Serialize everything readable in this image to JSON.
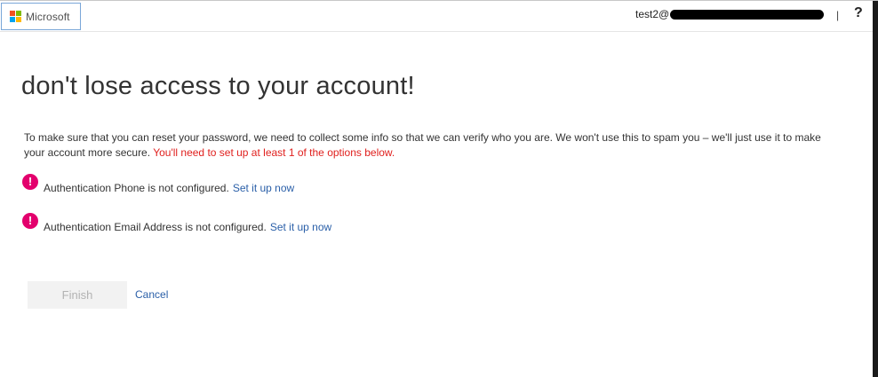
{
  "header": {
    "logo_text": "Microsoft",
    "user_prefix": "test2@",
    "separator": "|",
    "help": "?"
  },
  "logo_colors": [
    "#f25022",
    "#7fba00",
    "#00a4ef",
    "#ffb900"
  ],
  "main": {
    "title": "don't lose access to your account!",
    "intro_text": "To make sure that you can reset your password, we need to collect some info so that we can verify who you are. We won't use this to spam you – we'll just use it to make your account more secure.",
    "intro_warning": "You'll need to set up at least 1 of the options below.",
    "items": [
      {
        "icon": "!",
        "text": "Authentication Phone is not configured.",
        "link": "Set it up now"
      },
      {
        "icon": "!",
        "text": "Authentication Email Address is not configured.",
        "link": "Set it up now"
      }
    ],
    "finish_label": "Finish",
    "cancel_label": "Cancel"
  },
  "colors": {
    "alert": "#e3006d",
    "link": "#2a5fa8",
    "warning": "#e0201e"
  }
}
